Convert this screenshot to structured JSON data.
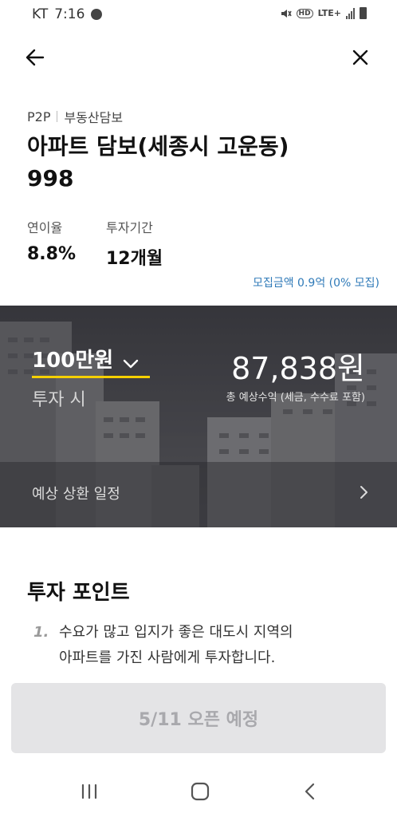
{
  "status_bar": {
    "carrier": "KT",
    "time": "7:16",
    "network": "LTE+",
    "hd_label": "HD"
  },
  "nav": {
    "back_icon": "arrow-left-icon",
    "close_icon": "close-icon"
  },
  "product": {
    "category": "P2P",
    "subcategory": "부동산담보",
    "title": "아파트 담보(세종시 고운동)",
    "number": "998",
    "rate_label": "연이율",
    "rate_value": "8.8%",
    "period_label": "투자기간",
    "period_value": "12개월",
    "recruit_text": "모집금액 0.9억 (0% 모집)"
  },
  "hero": {
    "amount": "100만원",
    "amount_sub": "투자 시",
    "expected_return": "87,838원",
    "expected_note": "총 예상수익 (세금, 수수료 포함)",
    "schedule_label": "예상 상환 일정",
    "accent_color": "#f5d000"
  },
  "invest_point": {
    "title": "투자 포인트",
    "items": [
      {
        "num": "1.",
        "line1": "수요가 많고 입지가 좋은 대도시 지역의",
        "line2": "아파트를 가진 사람에게 투자합니다."
      }
    ]
  },
  "cta": {
    "label": "5/11 오픈 예정"
  },
  "system_nav": {
    "recent": "recent-apps-icon",
    "home": "home-icon",
    "back": "back-icon"
  }
}
